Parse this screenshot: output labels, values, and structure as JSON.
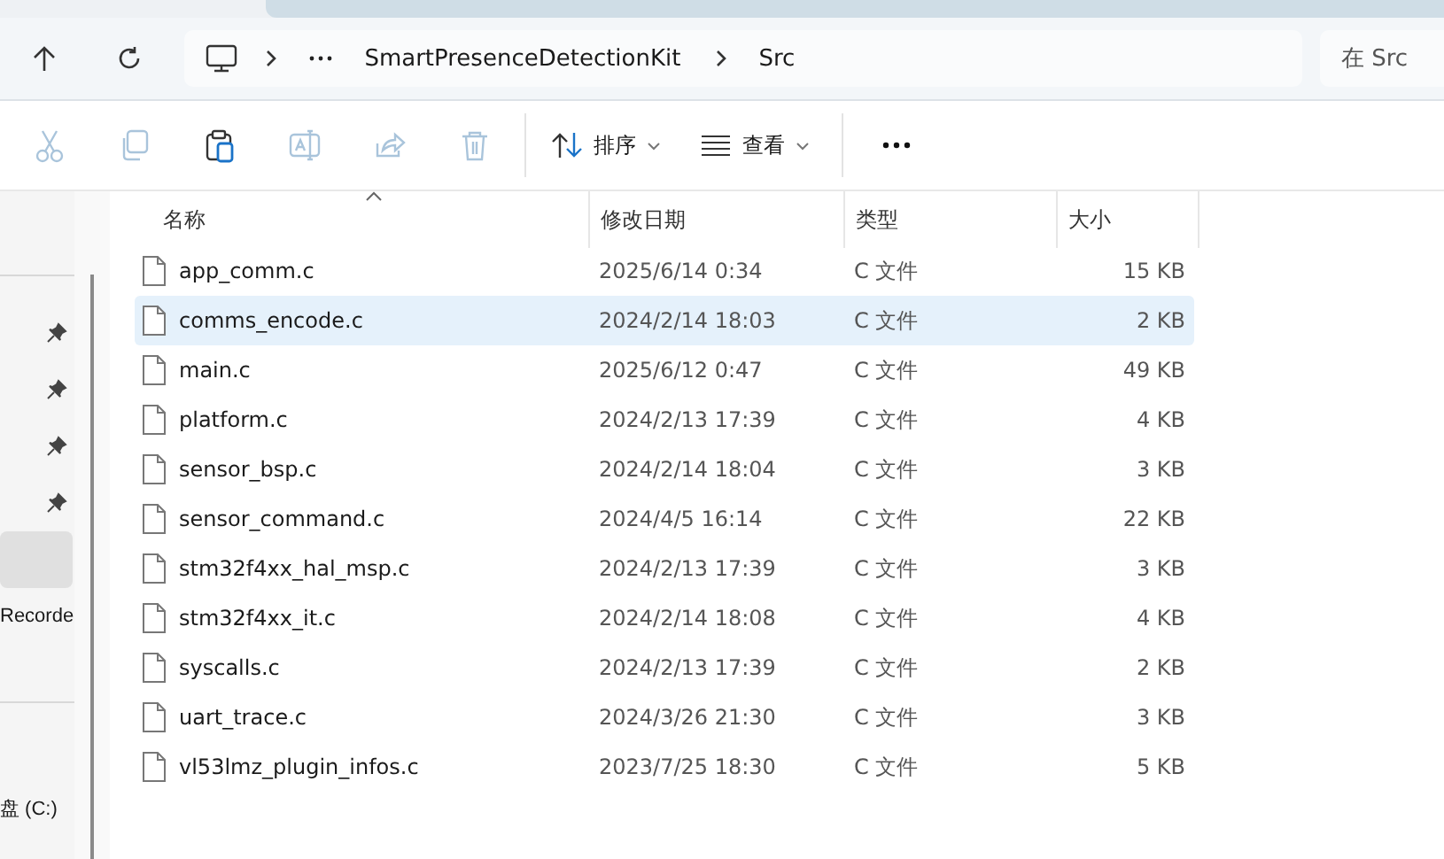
{
  "address_bar": {
    "crumbs": [
      "SmartPresenceDetectionKit",
      "Src"
    ]
  },
  "search": {
    "placeholder": "在 Src"
  },
  "toolbar": {
    "actions": [
      {
        "kind": "cut",
        "disabled": true
      },
      {
        "kind": "copy",
        "disabled": true
      },
      {
        "kind": "paste",
        "disabled": false
      },
      {
        "kind": "rename",
        "disabled": true
      },
      {
        "kind": "share",
        "disabled": true
      },
      {
        "kind": "delete",
        "disabled": true
      }
    ],
    "sort": {
      "label": "排序"
    },
    "view": {
      "label": "查看"
    }
  },
  "sidebar": {
    "items": [
      {
        "pinned": true,
        "selected": false
      },
      {
        "pinned": true,
        "selected": false
      },
      {
        "pinned": true,
        "selected": false
      },
      {
        "pinned": true,
        "selected": false
      },
      {
        "pinned": false,
        "selected": true
      },
      {
        "label": "Recorde",
        "selected": false
      }
    ],
    "drive": "盘 (C:)"
  },
  "table": {
    "columns": [
      "名称",
      "修改日期",
      "类型",
      "大小"
    ],
    "rows": [
      {
        "name": "app_comm.c",
        "modified": "2025/6/14 0:34",
        "type": "C 文件",
        "size": "15 KB",
        "selected": false
      },
      {
        "name": "comms_encode.c",
        "modified": "2024/2/14 18:03",
        "type": "C 文件",
        "size": "2 KB",
        "selected": true
      },
      {
        "name": "main.c",
        "modified": "2025/6/12 0:47",
        "type": "C 文件",
        "size": "49 KB",
        "selected": false
      },
      {
        "name": "platform.c",
        "modified": "2024/2/13 17:39",
        "type": "C 文件",
        "size": "4 KB",
        "selected": false
      },
      {
        "name": "sensor_bsp.c",
        "modified": "2024/2/14 18:04",
        "type": "C 文件",
        "size": "3 KB",
        "selected": false
      },
      {
        "name": "sensor_command.c",
        "modified": "2024/4/5 16:14",
        "type": "C 文件",
        "size": "22 KB",
        "selected": false
      },
      {
        "name": "stm32f4xx_hal_msp.c",
        "modified": "2024/2/13 17:39",
        "type": "C 文件",
        "size": "3 KB",
        "selected": false
      },
      {
        "name": "stm32f4xx_it.c",
        "modified": "2024/2/14 18:08",
        "type": "C 文件",
        "size": "4 KB",
        "selected": false
      },
      {
        "name": "syscalls.c",
        "modified": "2024/2/13 17:39",
        "type": "C 文件",
        "size": "2 KB",
        "selected": false
      },
      {
        "name": "uart_trace.c",
        "modified": "2024/3/26 21:30",
        "type": "C 文件",
        "size": "3 KB",
        "selected": false
      },
      {
        "name": "vl53lmz_plugin_infos.c",
        "modified": "2023/7/25 18:30",
        "type": "C 文件",
        "size": "5 KB",
        "selected": false
      }
    ]
  }
}
